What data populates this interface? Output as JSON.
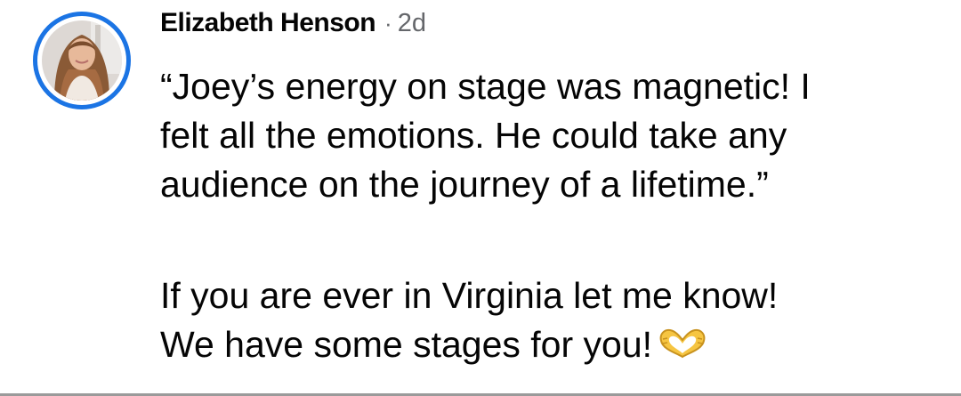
{
  "comment": {
    "author": "Elizabeth Henson",
    "separator": "·",
    "time": "2d",
    "paragraph_1": {
      "line_1": "“Joey’s energy on stage was magnetic! I",
      "line_2": "felt all the emotions. He could take any",
      "line_3": "audience on the journey of a lifetime.”"
    },
    "paragraph_2": {
      "line_1": "If you are ever in Virginia let me know!",
      "line_2": "We have some stages for you!"
    },
    "emoji": "heart-hands-emoji"
  },
  "colors": {
    "author_text": "#050505",
    "meta_text": "#65676b",
    "avatar_ring": "#1b74e4",
    "divider": "#9a9a9a"
  }
}
